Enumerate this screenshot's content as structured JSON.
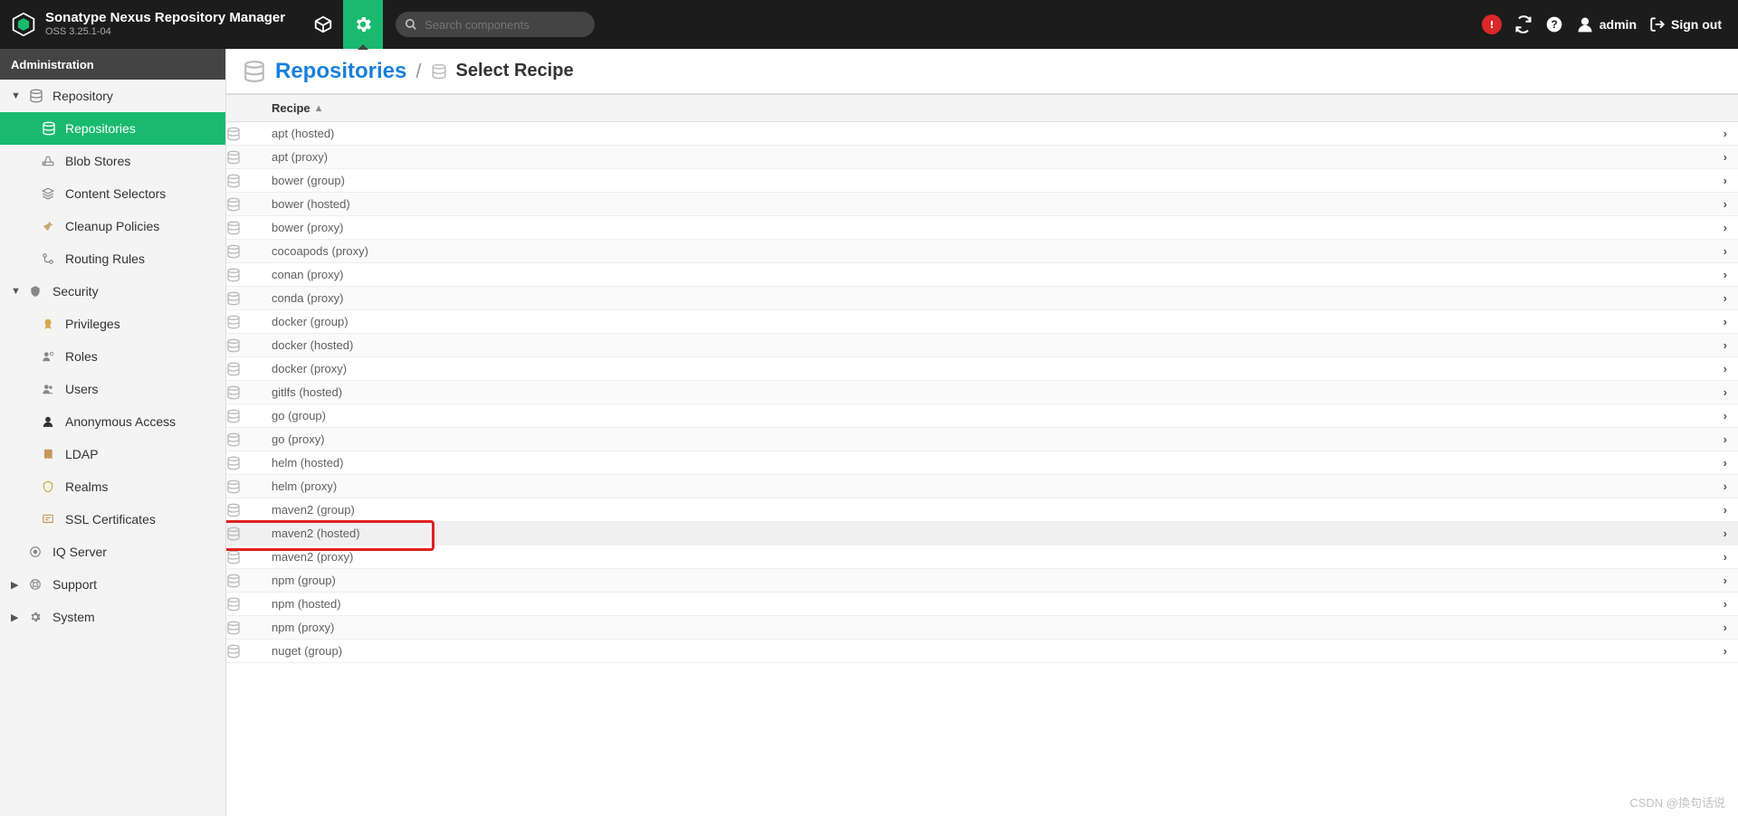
{
  "header": {
    "title": "Sonatype Nexus Repository Manager",
    "subtitle": "OSS 3.25.1-04",
    "search_placeholder": "Search components",
    "user": "admin",
    "signout": "Sign out"
  },
  "sidebar": {
    "section": "Administration",
    "tree": [
      {
        "label": "Repository",
        "level": 1,
        "expanded": true,
        "icon": "db"
      },
      {
        "label": "Repositories",
        "level": 2,
        "selected": true,
        "icon": "db"
      },
      {
        "label": "Blob Stores",
        "level": 2,
        "icon": "hdd"
      },
      {
        "label": "Content Selectors",
        "level": 2,
        "icon": "layers"
      },
      {
        "label": "Cleanup Policies",
        "level": 2,
        "icon": "broom"
      },
      {
        "label": "Routing Rules",
        "level": 2,
        "icon": "route"
      },
      {
        "label": "Security",
        "level": 1,
        "expanded": true,
        "icon": "shield"
      },
      {
        "label": "Privileges",
        "level": 2,
        "icon": "badge"
      },
      {
        "label": "Roles",
        "level": 2,
        "icon": "usergear"
      },
      {
        "label": "Users",
        "level": 2,
        "icon": "users"
      },
      {
        "label": "Anonymous Access",
        "level": 2,
        "icon": "anon"
      },
      {
        "label": "LDAP",
        "level": 2,
        "icon": "book"
      },
      {
        "label": "Realms",
        "level": 2,
        "icon": "realm"
      },
      {
        "label": "SSL Certificates",
        "level": 2,
        "icon": "cert"
      },
      {
        "label": "IQ Server",
        "level": 1,
        "icon": "iq"
      },
      {
        "label": "Support",
        "level": 1,
        "icon": "lifebuoy",
        "collapsed": true
      },
      {
        "label": "System",
        "level": 1,
        "icon": "gear",
        "collapsed": true
      }
    ]
  },
  "breadcrumb": {
    "root": "Repositories",
    "current": "Select Recipe"
  },
  "grid": {
    "header": "Recipe",
    "highlight_index": 17,
    "rows": [
      "apt (hosted)",
      "apt (proxy)",
      "bower (group)",
      "bower (hosted)",
      "bower (proxy)",
      "cocoapods (proxy)",
      "conan (proxy)",
      "conda (proxy)",
      "docker (group)",
      "docker (hosted)",
      "docker (proxy)",
      "gitlfs (hosted)",
      "go (group)",
      "go (proxy)",
      "helm (hosted)",
      "helm (proxy)",
      "maven2 (group)",
      "maven2 (hosted)",
      "maven2 (proxy)",
      "npm (group)",
      "npm (hosted)",
      "npm (proxy)",
      "nuget (group)"
    ]
  },
  "watermark": "CSDN @換句话说"
}
